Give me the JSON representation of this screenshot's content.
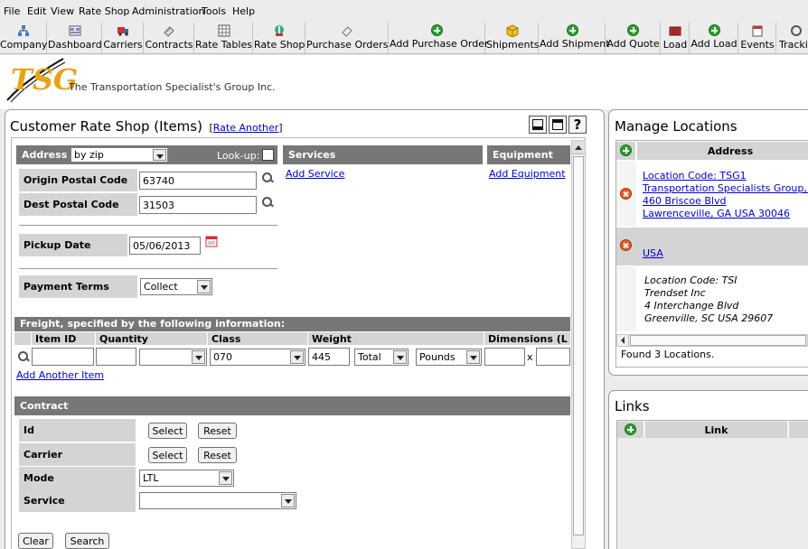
{
  "menu": [
    "File",
    "Edit",
    "View",
    "Rate Shop",
    "Administration",
    "Tools",
    "Help"
  ],
  "toolbar": [
    {
      "label": "Company",
      "icon": "company-icon"
    },
    {
      "label": "Dashboard",
      "icon": "dashboard-icon"
    },
    {
      "label": "Carriers",
      "icon": "truck-icon"
    },
    {
      "label": "Contracts",
      "icon": "contract-icon"
    },
    {
      "label": "Rate Tables",
      "icon": "rate-table-icon"
    },
    {
      "label": "Rate Shop",
      "icon": "rate-shop-icon"
    },
    {
      "label": "Purchase Orders",
      "icon": "purchase-orders-icon"
    },
    {
      "label": "Add Purchase Order",
      "icon": "add-icon"
    },
    {
      "label": "Shipments",
      "icon": "shipments-icon"
    },
    {
      "label": "Add Shipment",
      "icon": "add-icon"
    },
    {
      "label": "Add Quote",
      "icon": "add-icon"
    },
    {
      "label": "Load",
      "icon": "load-icon"
    },
    {
      "label": "Add Load",
      "icon": "add-icon"
    },
    {
      "label": "Events",
      "icon": "events-icon"
    },
    {
      "label": "Tracking",
      "icon": "tracking-icon"
    }
  ],
  "logo": {
    "mark": "TSG",
    "tagline": "The Transportation Specialist's Group Inc."
  },
  "rate_shop": {
    "title": "Customer Rate Shop (Items)",
    "rate_another": "Rate Another",
    "address": {
      "label": "Address",
      "mode": "by zip",
      "lookup_label": "Look-up:"
    },
    "origin": {
      "label": "Origin Postal Code",
      "value": "63740"
    },
    "dest": {
      "label": "Dest Postal Code",
      "value": "31503"
    },
    "pickup": {
      "label": "Pickup Date",
      "value": "05/06/2013"
    },
    "payment": {
      "label": "Payment Terms",
      "value": "Collect"
    },
    "services": {
      "label": "Services",
      "add": "Add Service"
    },
    "equipment": {
      "label": "Equipment",
      "add": "Add Equipment"
    },
    "freight": {
      "header": "Freight, specified by the following information:",
      "columns": [
        "Item ID",
        "Quantity",
        "Class",
        "Weight",
        "Dimensions (L x"
      ],
      "row": {
        "item_id": "",
        "quantity": "",
        "class_prefix": "",
        "class": "070",
        "weight": "445",
        "weight_type": "Total",
        "weight_unit": "Pounds",
        "dim_sep": "x"
      },
      "add_item": "Add Another Item"
    },
    "contract": {
      "header": "Contract",
      "id_label": "Id",
      "carrier_label": "Carrier",
      "mode_label": "Mode",
      "mode_value": "LTL",
      "service_label": "Service",
      "service_value": "",
      "select": "Select",
      "reset": "Reset"
    },
    "buttons": {
      "clear": "Clear",
      "search": "Search"
    }
  },
  "manage_locations": {
    "title": "Manage Locations",
    "column": "Address",
    "loc1": [
      "Location Code: TSG1",
      "Transportation Specialists Group, Inc",
      "460 Briscoe Blvd",
      "Lawrenceville,  GA  USA  30046"
    ],
    "loc2": [
      "USA"
    ],
    "loc3": [
      "Location Code: TSI",
      "Trendset Inc",
      "4 Interchange Blvd",
      "Greenville,  SC  USA  29607"
    ],
    "found": "Found 3 Locations."
  },
  "links": {
    "title": "Links",
    "column": "Link"
  },
  "colors": {
    "section_bar": "#777777",
    "label_cell": "#d4d4d4",
    "link": "#0000cc",
    "add": "#2ca02c",
    "delete": "#e25b24"
  }
}
